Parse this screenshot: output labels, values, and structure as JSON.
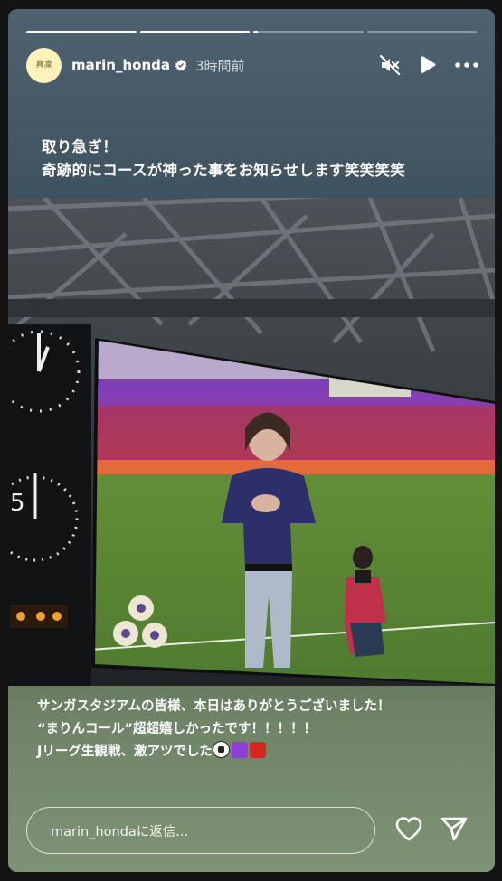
{
  "progress": [
    1,
    1,
    0.04,
    0
  ],
  "header": {
    "avatar_text": "真凜",
    "username": "marin_honda",
    "time_ago": "3時間前"
  },
  "caption_top": {
    "line1": "取り急ぎ！",
    "line2": "奇跡的にコースが神った事をお知らせします笑笑笑笑"
  },
  "scoreboard": {
    "digit": "5"
  },
  "caption_bottom": {
    "line1": "サンガスタジアムの皆様、本日はありがとうございました！",
    "line2": "“まりんコール”超超嬉しかったです！！！！！",
    "line3": "Jリーグ生観戦、激アツでした"
  },
  "emoji_colors": {
    "purple": "#8e3fd6",
    "red": "#d42a1e"
  },
  "reply": {
    "placeholder": "marin_hondaに返信..."
  }
}
